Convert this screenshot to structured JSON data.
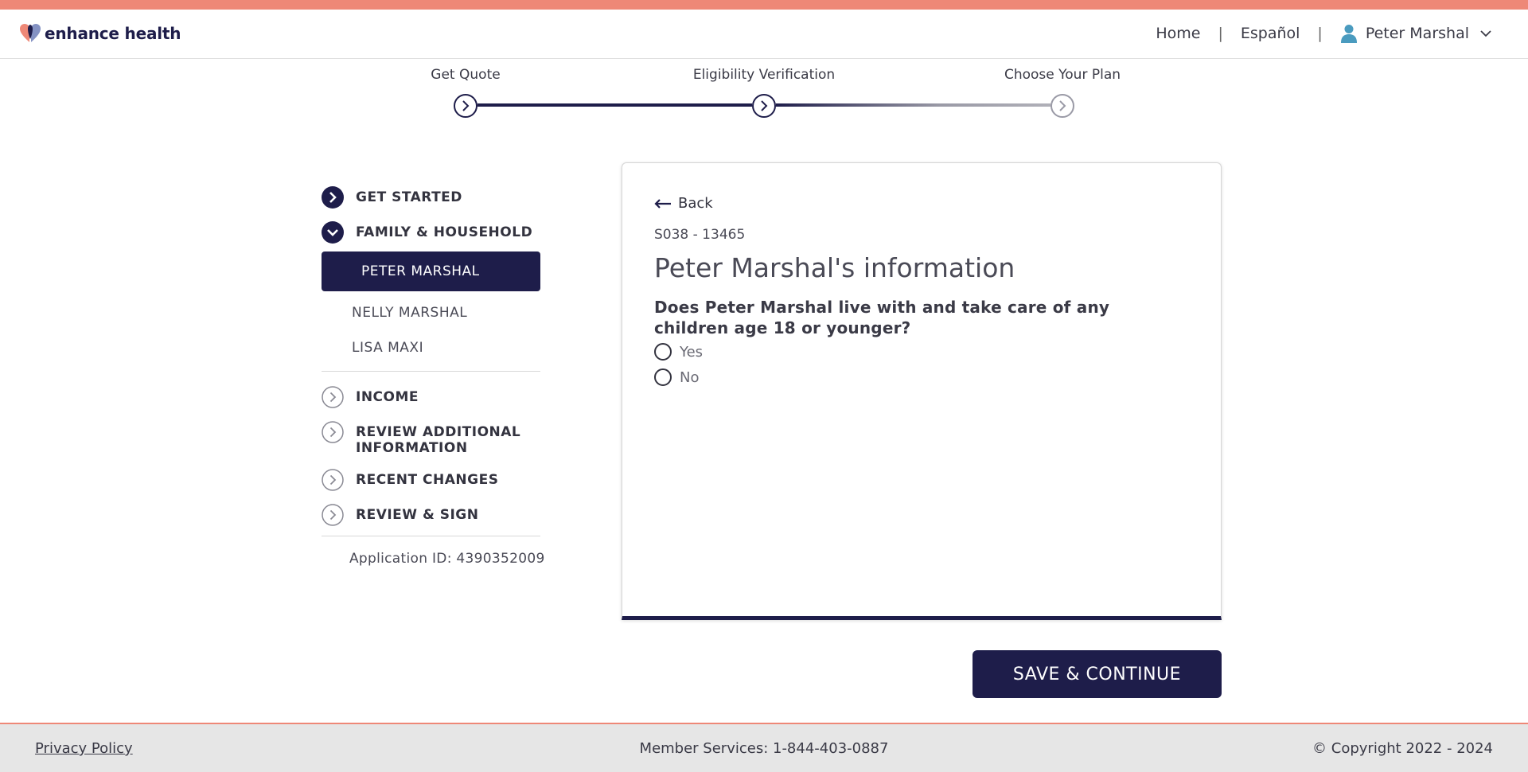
{
  "brand": {
    "name": "enhance health",
    "colors": {
      "navy": "#1e1d4a",
      "coral": "#ee8877",
      "heart_blue": "#6e7fb8"
    }
  },
  "nav": {
    "home": "Home",
    "language": "Español",
    "user_name": "Peter Marshal",
    "separator": "|"
  },
  "stepper": {
    "steps": [
      {
        "label": "Get Quote",
        "state": "complete"
      },
      {
        "label": "Eligibility Verification",
        "state": "current"
      },
      {
        "label": "Choose Your Plan",
        "state": "upcoming"
      }
    ]
  },
  "sidebar": {
    "sections": [
      {
        "label": "GET STARTED",
        "icon": "chevron-right-filled-icon"
      },
      {
        "label": "FAMILY & HOUSEHOLD",
        "icon": "chevron-down-filled-icon",
        "members": [
          "PETER MARSHAL",
          "NELLY MARSHAL",
          "LISA MAXI"
        ],
        "active_member": "PETER MARSHAL"
      },
      {
        "label": "INCOME",
        "icon": "chevron-right-outline-icon"
      },
      {
        "label": "REVIEW ADDITIONAL INFORMATION",
        "icon": "chevron-right-outline-icon"
      },
      {
        "label": "RECENT CHANGES",
        "icon": "chevron-right-outline-icon"
      },
      {
        "label": "REVIEW & SIGN",
        "icon": "chevron-right-outline-icon"
      }
    ],
    "application_id": "Application ID: 4390352009"
  },
  "form": {
    "back_label": "Back",
    "code": "S038 - 13465",
    "title": "Peter Marshal's information",
    "question": "Does Peter Marshal live with and take care of any children age 18 or younger?",
    "options": [
      "Yes",
      "No"
    ]
  },
  "actions": {
    "save_continue": "SAVE & CONTINUE"
  },
  "footer": {
    "privacy": "Privacy Policy",
    "member_services": "Member Services: 1-844-403-0887",
    "copyright": "© Copyright 2022 - 2024"
  }
}
